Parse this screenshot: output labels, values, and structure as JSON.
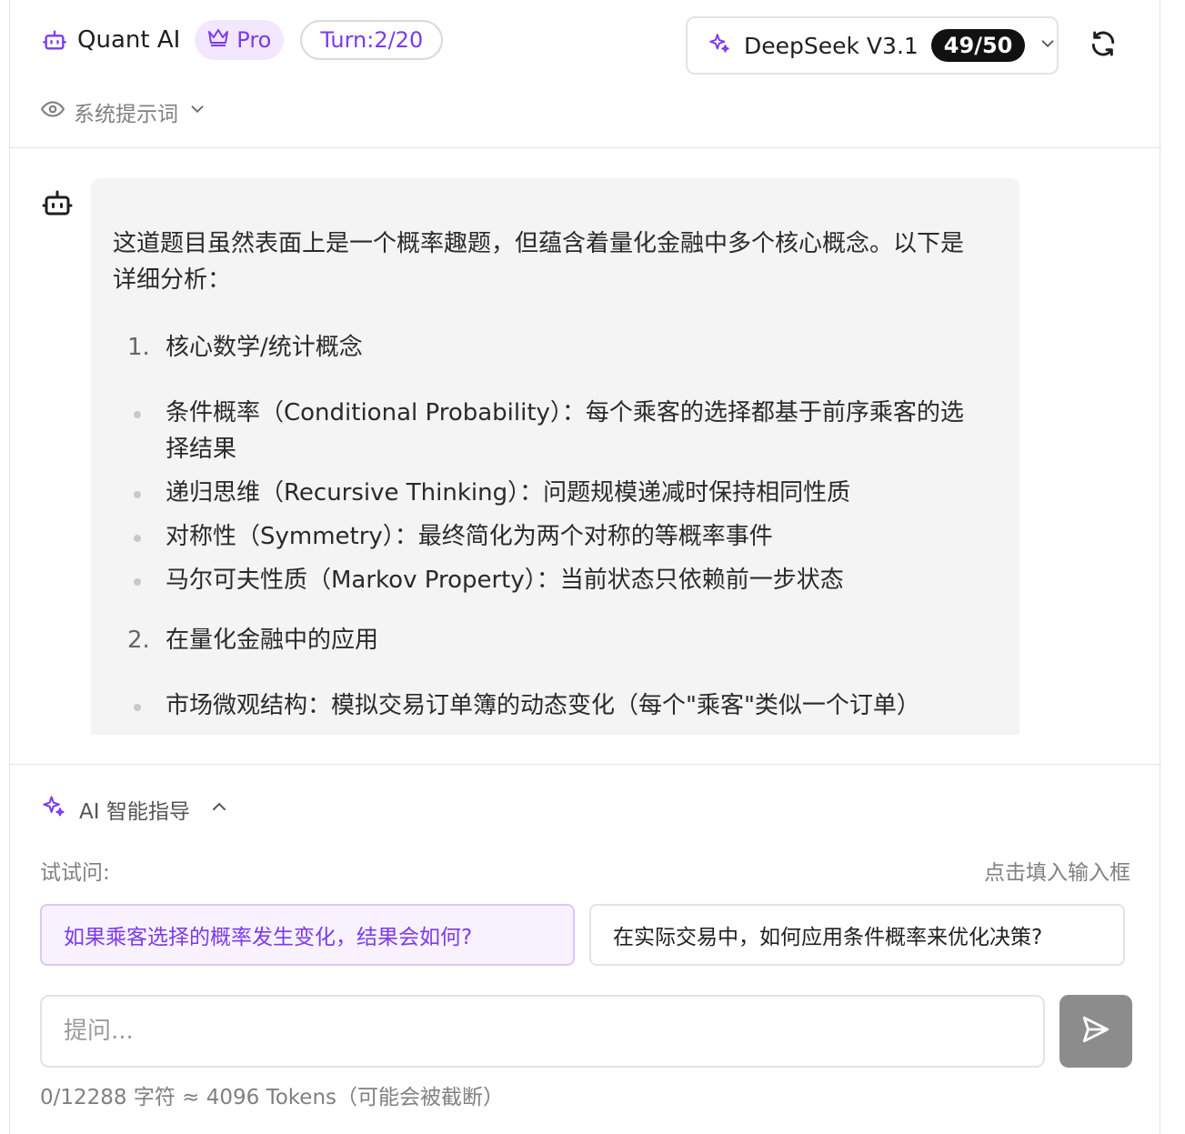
{
  "header": {
    "brand_icon": "robot-icon",
    "app_name": "Quant AI",
    "plan_label": "Pro",
    "plan_icon": "crown-icon",
    "turn_label": "Turn:2/20",
    "model": {
      "icon": "sparkles-icon",
      "name": "DeepSeek V3.1",
      "count": "49/50",
      "chevron": "chevron-down-icon"
    },
    "refresh_icon": "refresh-icon",
    "system_prompt": {
      "icon": "eye-icon",
      "label": "系统提示词",
      "chevron": "chevron-down-icon"
    }
  },
  "message": {
    "avatar_icon": "robot-icon",
    "intro": "这道题目虽然表面上是一个概率趣题，但蕴含着量化金融中多个核心概念。以下是详细分析：",
    "sections": [
      {
        "number": "1.",
        "title": "核心数学/统计概念",
        "bullets": [
          "条件概率（Conditional Probability）：每个乘客的选择都基于前序乘客的选择结果",
          "递归思维（Recursive Thinking）：问题规模递减时保持相同性质",
          "对称性（Symmetry）：最终简化为两个对称的等概率事件",
          "马尔可夫性质（Markov Property）：当前状态只依赖前一步状态"
        ]
      },
      {
        "number": "2.",
        "title": "在量化金融中的应用",
        "bullets": [
          "市场微观结构：模拟交易订单簿的动态变化（每个\"乘客\"类似一个订单）"
        ]
      }
    ]
  },
  "guide": {
    "icon": "sparkles-icon",
    "title": "AI 智能指导",
    "chevron": "chevron-up-icon",
    "try_label": "试试问:",
    "fill_hint": "点击填入输入框",
    "suggestions": [
      "如果乘客选择的概率发生变化，结果会如何?",
      "在实际交易中，如何应用条件概率来优化决策?"
    ]
  },
  "composer": {
    "placeholder": "提问...",
    "value": "",
    "send_icon": "send-icon",
    "counter": "0/12288 字符 ≈ 4096 Tokens（可能会被截断）"
  },
  "colors": {
    "accent": "#7c3aed",
    "accent_bg": "#f2e7fd",
    "send_bg": "#8c8c8c",
    "bubble_bg": "#f4f4f4"
  }
}
